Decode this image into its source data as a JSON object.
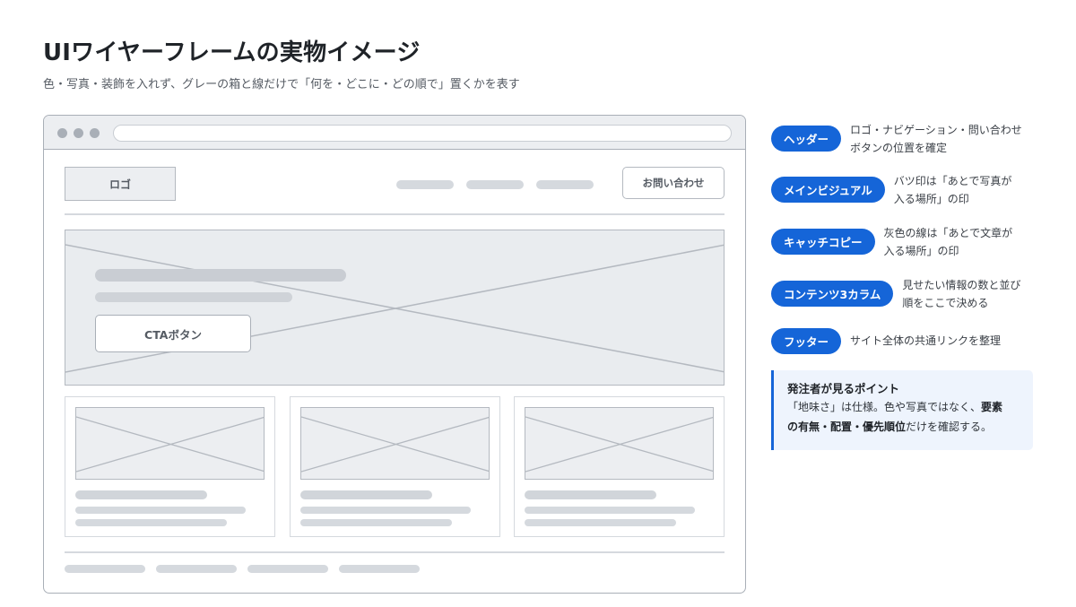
{
  "title": "UIワイヤーフレームの実物イメージ",
  "subtitle": "色・写真・装飾を入れず、グレーの箱と線だけで「何を・どこに・どの順で」置くかを表す",
  "wireframe": {
    "logo_label": "ロゴ",
    "contact_label": "お問い合わせ",
    "cta_label": "CTAボタン"
  },
  "legend": [
    {
      "badge": "ヘッダー",
      "line1": "ロゴ・ナビゲーション・問い合わせ",
      "line2": "ボタンの位置を確定"
    },
    {
      "badge": "メインビジュアル",
      "line1": "バツ印は「あとで写真が",
      "line2": "入る場所」の印"
    },
    {
      "badge": "キャッチコピー",
      "line1": "灰色の線は「あとで文章が",
      "line2": "入る場所」の印"
    },
    {
      "badge": "コンテンツ3カラム",
      "line1": "見せたい情報の数と並び",
      "line2": "順をここで決める"
    },
    {
      "badge": "フッター",
      "line1": "サイト全体の共通リンクを整理",
      "line2": ""
    }
  ],
  "point": {
    "title": "発注者が見るポイント",
    "body_a": "「地味さ」は仕様。色や写真ではなく、",
    "body_strong_a": "要素",
    "body_strong_b": "の有無・配置・優先順位",
    "body_b": "だけを確認する。"
  },
  "colors": {
    "accent": "#1565d8",
    "wire_fill": "#eceef1",
    "wire_line": "#b4b9c0",
    "placeholder_bar": "#d5d9de"
  }
}
